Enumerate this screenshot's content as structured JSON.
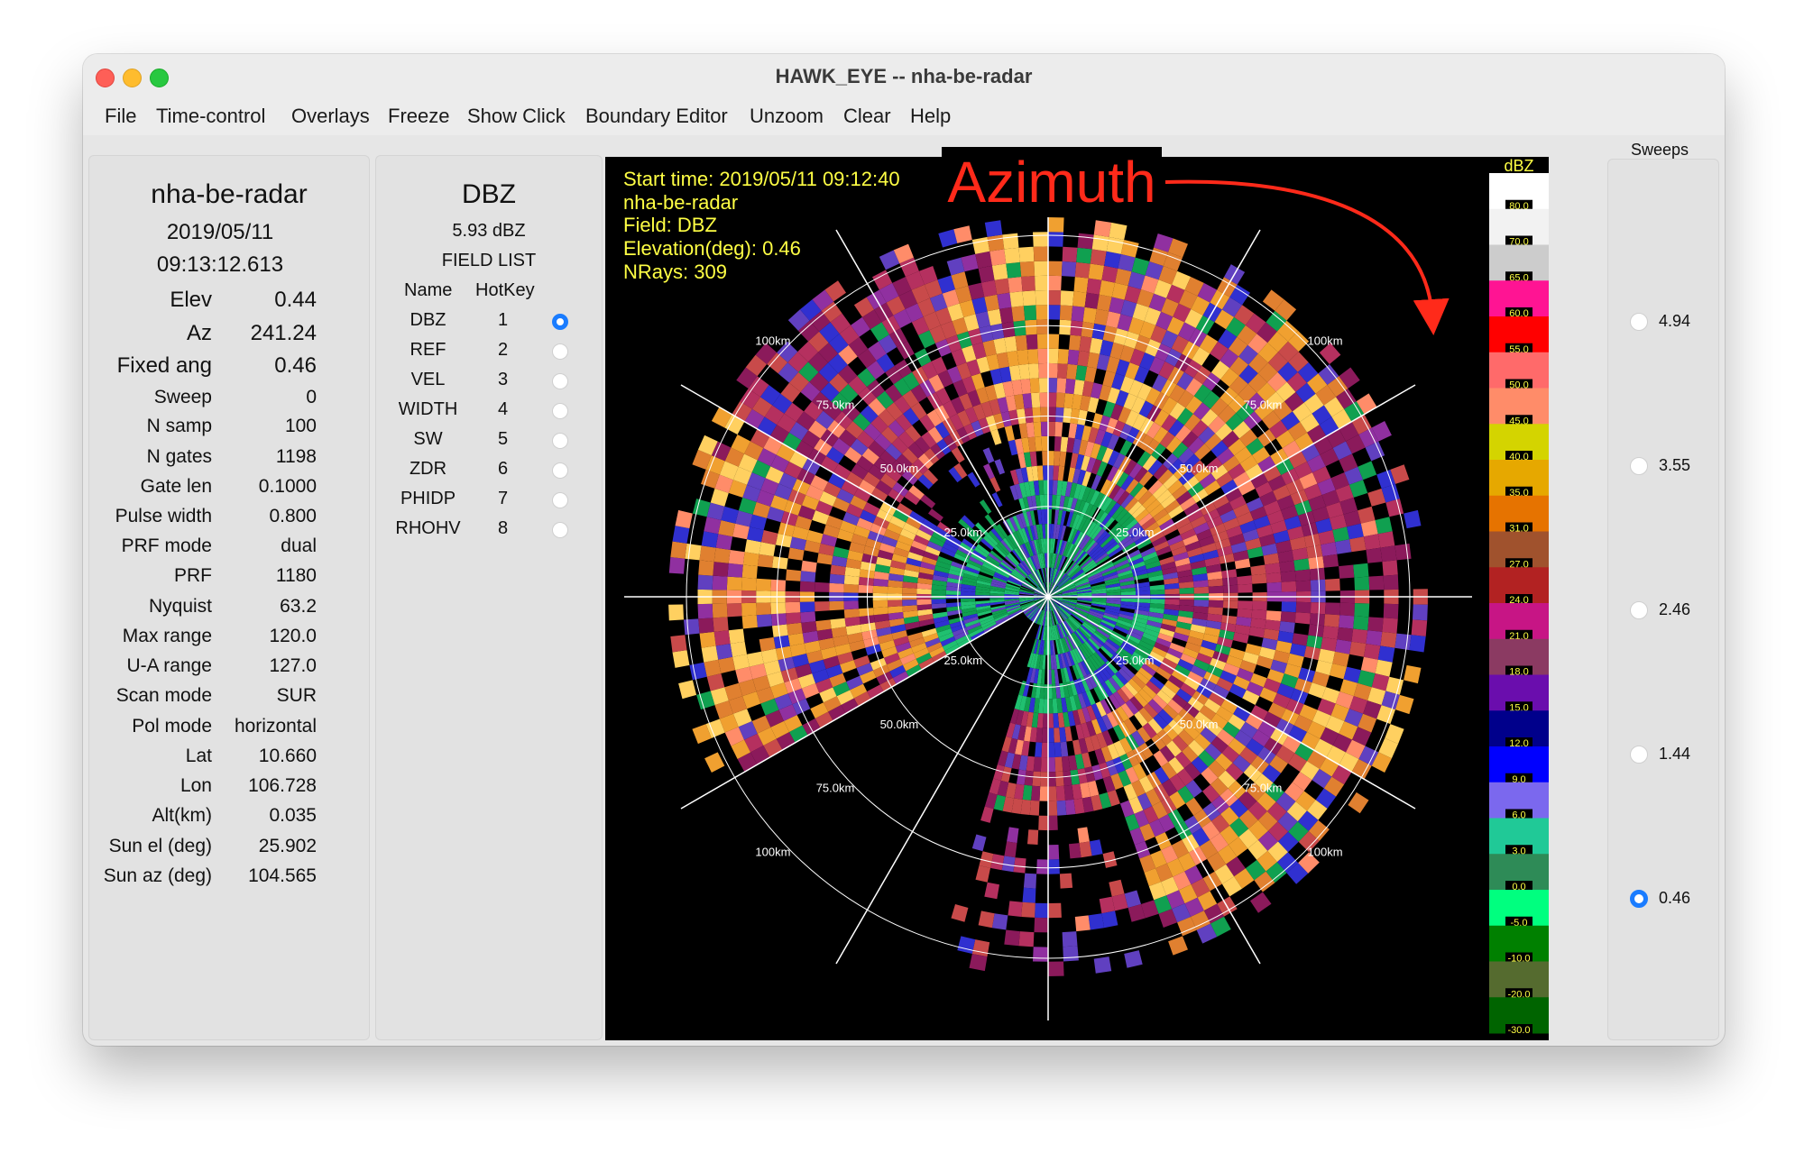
{
  "window": {
    "title": "HAWK_EYE -- nha-be-radar"
  },
  "menu": [
    "File",
    "Time-control",
    "Overlays",
    "Freeze",
    "Show Click",
    "Boundary Editor",
    "Unzoom",
    "Clear",
    "Help"
  ],
  "info": {
    "radar_name": "nha-be-radar",
    "date": "2019/05/11",
    "time": "09:13:12.613",
    "rows": [
      {
        "key": "Elev",
        "val": "0.44"
      },
      {
        "key": "Az",
        "val": "241.24"
      },
      {
        "key": "Fixed ang",
        "val": "0.46"
      },
      {
        "key": "Sweep",
        "val": "0"
      },
      {
        "key": "N samp",
        "val": "100"
      },
      {
        "key": "N gates",
        "val": "1198"
      },
      {
        "key": "Gate len",
        "val": "0.1000"
      },
      {
        "key": "Pulse width",
        "val": "0.800"
      },
      {
        "key": "PRF mode",
        "val": "dual"
      },
      {
        "key": "PRF",
        "val": "1180"
      },
      {
        "key": "Nyquist",
        "val": "63.2"
      },
      {
        "key": "Max range",
        "val": "120.0"
      },
      {
        "key": "U-A range",
        "val": "127.0"
      },
      {
        "key": "Scan mode",
        "val": "SUR"
      },
      {
        "key": "Pol mode",
        "val": "horizontal"
      },
      {
        "key": "Lat",
        "val": "10.660"
      },
      {
        "key": "Lon",
        "val": "106.728"
      },
      {
        "key": "Alt(km)",
        "val": "0.035"
      },
      {
        "key": "Sun el (deg)",
        "val": "25.902"
      },
      {
        "key": "Sun az (deg)",
        "val": "104.565"
      }
    ]
  },
  "field_panel": {
    "title": "DBZ",
    "value": "5.93 dBZ",
    "list_title": "FIELD LIST",
    "col_name": "Name",
    "col_hotkey": "HotKey",
    "fields": [
      {
        "name": "DBZ",
        "hotkey": "1",
        "selected": true
      },
      {
        "name": "REF",
        "hotkey": "2",
        "selected": false
      },
      {
        "name": "VEL",
        "hotkey": "3",
        "selected": false
      },
      {
        "name": "WIDTH",
        "hotkey": "4",
        "selected": false
      },
      {
        "name": "SW",
        "hotkey": "5",
        "selected": false
      },
      {
        "name": "ZDR",
        "hotkey": "6",
        "selected": false
      },
      {
        "name": "PHIDP",
        "hotkey": "7",
        "selected": false
      },
      {
        "name": "RHOHV",
        "hotkey": "8",
        "selected": false
      }
    ]
  },
  "overlay": {
    "start_time": "Start time: 2019/05/11 09:12:40",
    "radar": "nha-be-radar",
    "field": "Field: DBZ",
    "elevation": "Elevation(deg): 0.46",
    "nrays": "NRays: 309",
    "annotation": "Azimuth",
    "annotation_color": "#ff2a1a"
  },
  "range_labels": [
    "25.0km",
    "50.0km",
    "75.0km",
    "100km"
  ],
  "colorscale": {
    "title": "dBZ",
    "entries": [
      {
        "label": "80.0",
        "color": "#ffffff"
      },
      {
        "label": "70.0",
        "color": "#f2f2f2"
      },
      {
        "label": "65.0",
        "color": "#cccccc"
      },
      {
        "label": "60.0",
        "color": "#ff1493"
      },
      {
        "label": "55.0",
        "color": "#ff0000"
      },
      {
        "label": "50.0",
        "color": "#ff6a6a"
      },
      {
        "label": "45.0",
        "color": "#ff8c69"
      },
      {
        "label": "40.0",
        "color": "#d4d400"
      },
      {
        "label": "35.0",
        "color": "#e6a800"
      },
      {
        "label": "31.0",
        "color": "#e67300"
      },
      {
        "label": "27.0",
        "color": "#a0522d"
      },
      {
        "label": "24.0",
        "color": "#b22222"
      },
      {
        "label": "21.0",
        "color": "#c71585"
      },
      {
        "label": "18.0",
        "color": "#8b3a62"
      },
      {
        "label": "15.0",
        "color": "#6a0dad"
      },
      {
        "label": "12.0",
        "color": "#00008b"
      },
      {
        "label": "9.0",
        "color": "#0000ff"
      },
      {
        "label": "6.0",
        "color": "#7b68ee"
      },
      {
        "label": "3.0",
        "color": "#20c997"
      },
      {
        "label": "0.0",
        "color": "#2e8b57"
      },
      {
        "label": "-5.0",
        "color": "#00ff7f"
      },
      {
        "label": "-10.0",
        "color": "#008000"
      },
      {
        "label": "-20.0",
        "color": "#556b2f"
      },
      {
        "label": "-30.0",
        "color": "#006400"
      }
    ]
  },
  "sweeps": {
    "title": "Sweeps",
    "items": [
      {
        "label": "4.94",
        "selected": false
      },
      {
        "label": "3.55",
        "selected": false
      },
      {
        "label": "2.46",
        "selected": false
      },
      {
        "label": "1.44",
        "selected": false
      },
      {
        "label": "0.46",
        "selected": true
      }
    ]
  }
}
